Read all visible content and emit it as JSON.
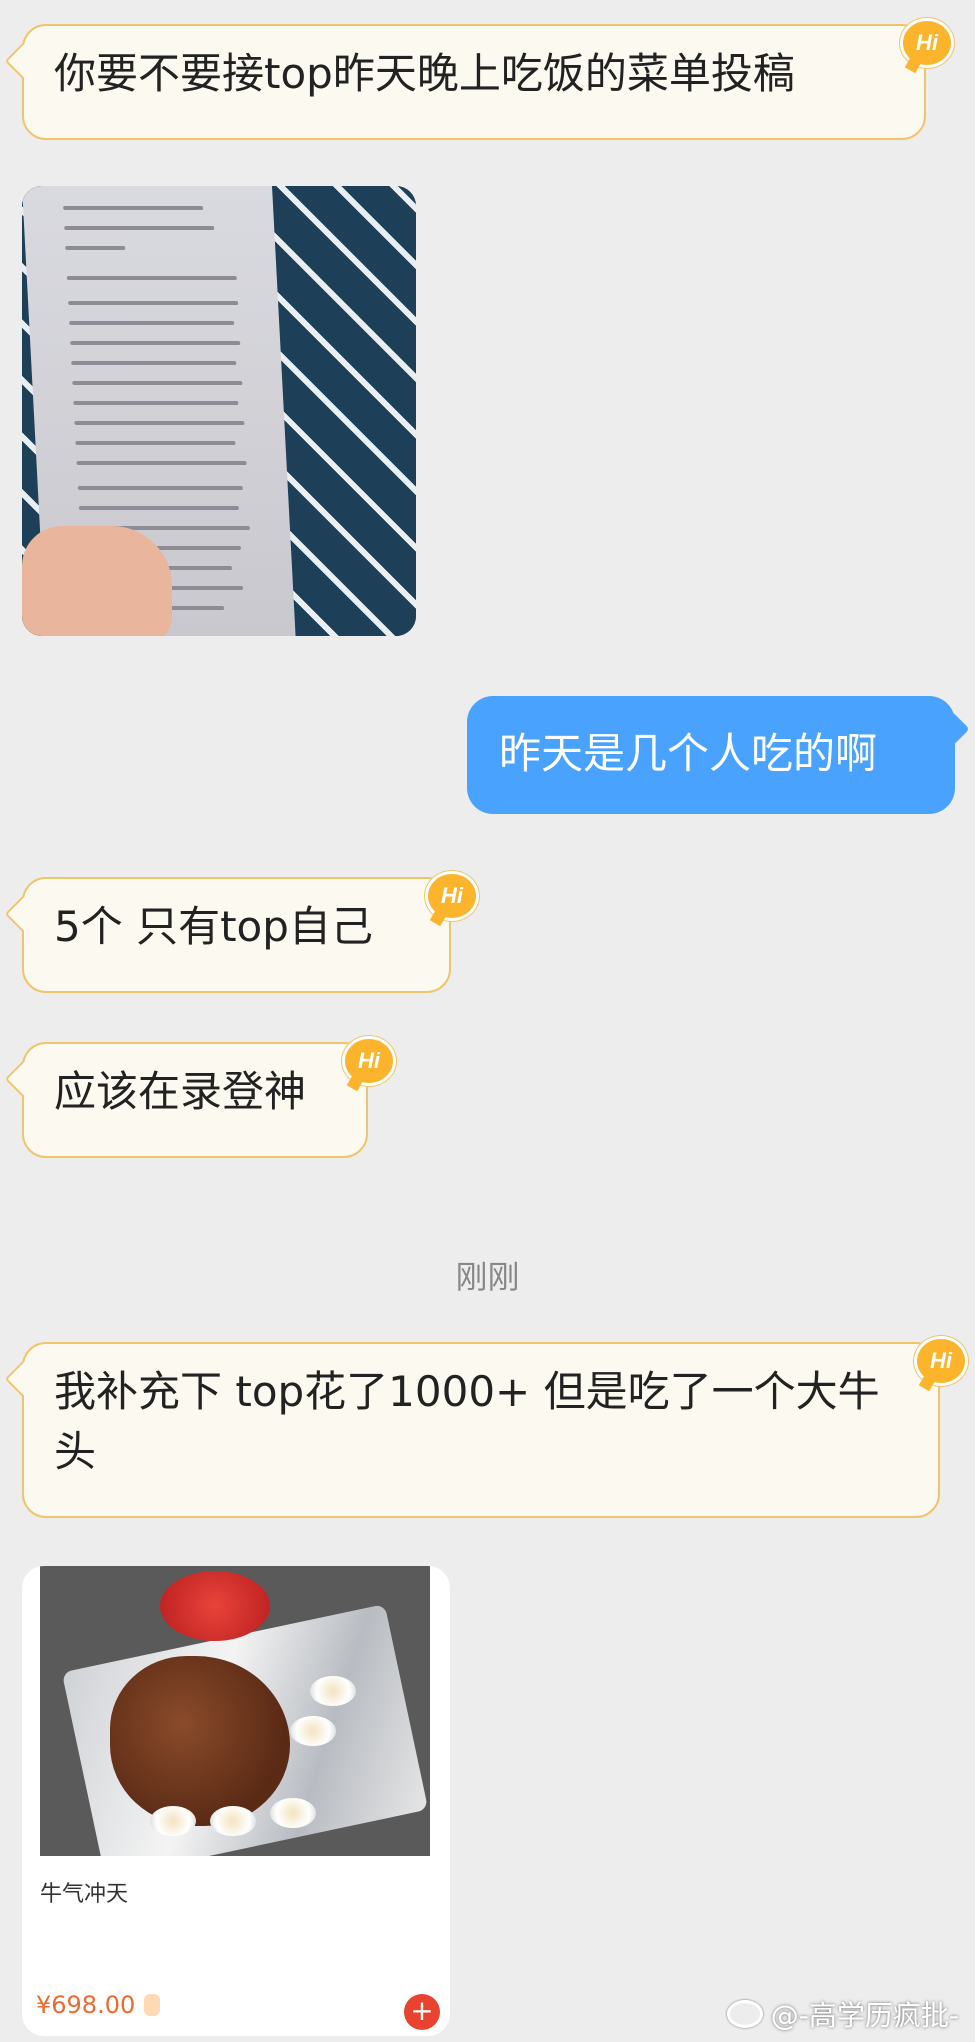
{
  "messages": [
    {
      "text": "你要不要接top昨天晚上吃饭的菜单投稿",
      "badge": "Hi"
    },
    {
      "text": "昨天是几个人吃的啊"
    },
    {
      "text": "5个 只有top自己",
      "badge": "Hi"
    },
    {
      "text": "应该在录登神",
      "badge": "Hi"
    },
    {
      "text": "我补充下 top花了1000+ 但是吃了一个大牛头",
      "badge": "Hi"
    }
  ],
  "timestamp": "刚刚",
  "product_card": {
    "title": "牛气冲天",
    "price": "¥698.00",
    "badge": "",
    "add_label": "+"
  },
  "watermark": "@-高学历疯批-"
}
